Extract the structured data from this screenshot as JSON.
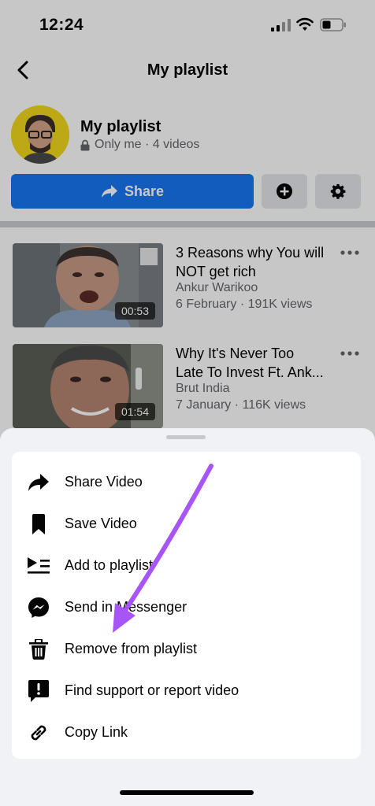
{
  "status_bar": {
    "time": "12:24"
  },
  "nav": {
    "title": "My playlist"
  },
  "playlist": {
    "title": "My playlist",
    "privacy_text": "Only me · 4 videos",
    "share_label": "Share"
  },
  "videos": [
    {
      "title_line1": "3 Reasons why You will",
      "title_line2": "NOT get rich",
      "channel": "Ankur Warikoo",
      "meta": "6 February · 191K views",
      "duration": "00:53"
    },
    {
      "title_line1": "Why It's Never Too",
      "title_line2": "Late To Invest Ft. Ank...",
      "channel": "Brut India",
      "meta": "7 January · 116K views",
      "duration": "01:54"
    }
  ],
  "sheet": {
    "items": [
      {
        "label": "Share Video",
        "icon": "share-arrow-icon"
      },
      {
        "label": "Save Video",
        "icon": "bookmark-icon"
      },
      {
        "label": "Add to playlist",
        "icon": "playlist-add-icon"
      },
      {
        "label": "Send in Messenger",
        "icon": "messenger-icon"
      },
      {
        "label": "Remove from playlist",
        "icon": "trash-icon"
      },
      {
        "label": "Find support or report video",
        "icon": "report-icon"
      },
      {
        "label": "Copy Link",
        "icon": "link-icon"
      }
    ]
  },
  "colors": {
    "accent": "#1877f2",
    "annotation_arrow": "#a855f7"
  }
}
